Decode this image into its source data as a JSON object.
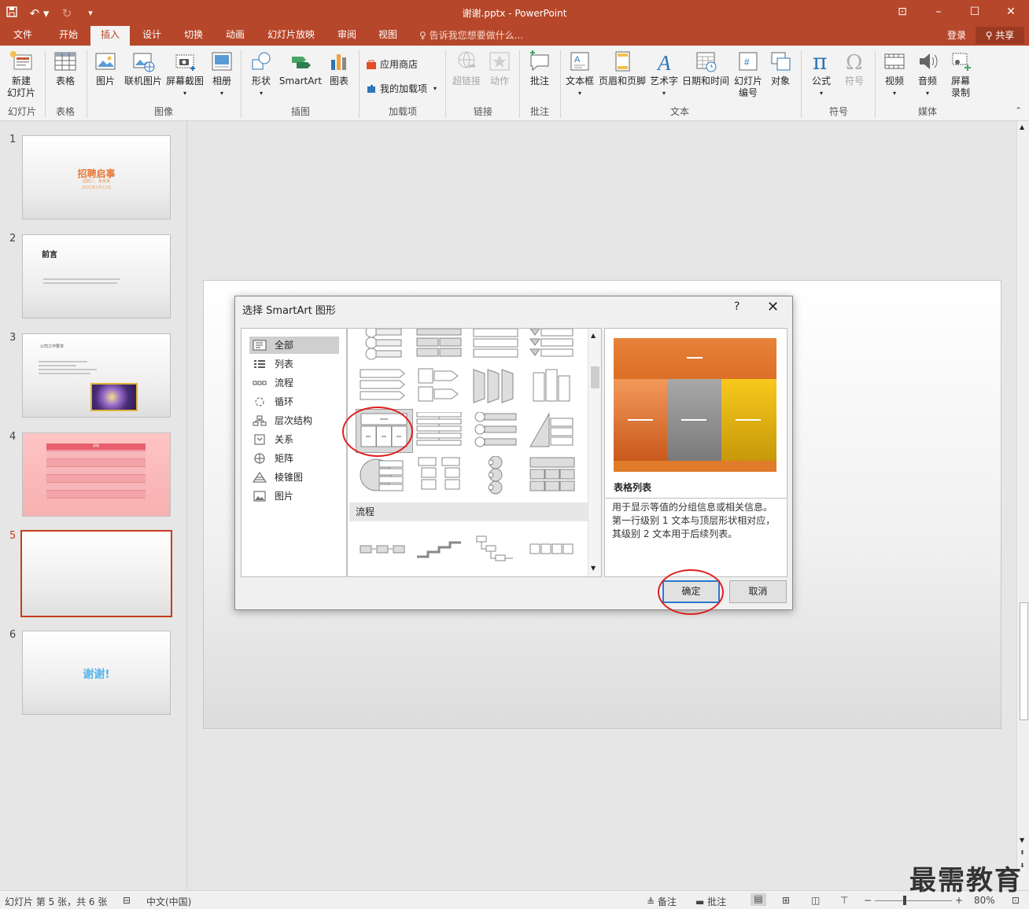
{
  "window": {
    "title": "谢谢.pptx - PowerPoint",
    "qat": {
      "save": "save-icon",
      "undo": "undo-icon",
      "redo": "redo-icon"
    }
  },
  "tabs": [
    "文件",
    "开始",
    "插入",
    "设计",
    "切换",
    "动画",
    "幻灯片放映",
    "审阅",
    "视图"
  ],
  "active_tab": "插入",
  "tellme": "告诉我您想要做什么...",
  "login": "登录",
  "share": "共享",
  "ribbon": {
    "new_slide": "新建\n幻灯片",
    "table": "表格",
    "picture": "图片",
    "online_picture": "联机图片",
    "screenshot": "屏幕截图",
    "album": "相册",
    "shapes": "形状",
    "smartart": "SmartArt",
    "chart": "图表",
    "store": "应用商店",
    "my_addins": "我的加载项",
    "hyperlink": "超链接",
    "action": "动作",
    "comment": "批注",
    "textbox": "文本框",
    "header_footer": "页眉和页脚",
    "wordart": "艺术字",
    "datetime": "日期和时间",
    "slide_number": "幻灯片\n编号",
    "object": "对象",
    "equation": "公式",
    "symbol": "符号",
    "video": "视频",
    "audio": "音频",
    "screen_record": "屏幕\n录制",
    "groups": {
      "slides": "幻灯片",
      "tables": "表格",
      "images": "图像",
      "illustrations": "插图",
      "addins": "加载项",
      "links": "链接",
      "comments": "批注",
      "text": "文本",
      "symbols": "符号",
      "media": "媒体"
    }
  },
  "slides": [
    {
      "num": "1",
      "title": "招聘启事",
      "sub1": "招聘人：某某某",
      "sub2": "2021年1月12日"
    },
    {
      "num": "2",
      "title": "前言"
    },
    {
      "num": "3",
      "title": "公司工作要求"
    },
    {
      "num": "4",
      "title": "表格"
    },
    {
      "num": "5",
      "title": ""
    },
    {
      "num": "6",
      "title": "谢谢!"
    }
  ],
  "selected_slide": "5",
  "dialog": {
    "title": "选择 SmartArt 图形",
    "help": "?",
    "categories": [
      "全部",
      "列表",
      "流程",
      "循环",
      "层次结构",
      "关系",
      "矩阵",
      "棱锥图",
      "图片"
    ],
    "selected_category": "全部",
    "section_label": "流程",
    "preview_name": "表格列表",
    "preview_desc": "用于显示等值的分组信息或相关信息。第一行级别 1 文本与顶层形状相对应，其级别 2 文本用于后续列表。",
    "ok": "确定",
    "cancel": "取消"
  },
  "status": {
    "slide_info": "幻灯片 第 5 张，共 6 张",
    "language": "中文(中国)",
    "notes": "备注",
    "comments": "批注",
    "zoom": "80%"
  },
  "watermark": "最需教育",
  "colors": {
    "accent": "#b7472a",
    "preview_orange": "#e07b2a",
    "preview_gray": "#8c8c8c",
    "preview_yellow": "#e8b80c"
  }
}
